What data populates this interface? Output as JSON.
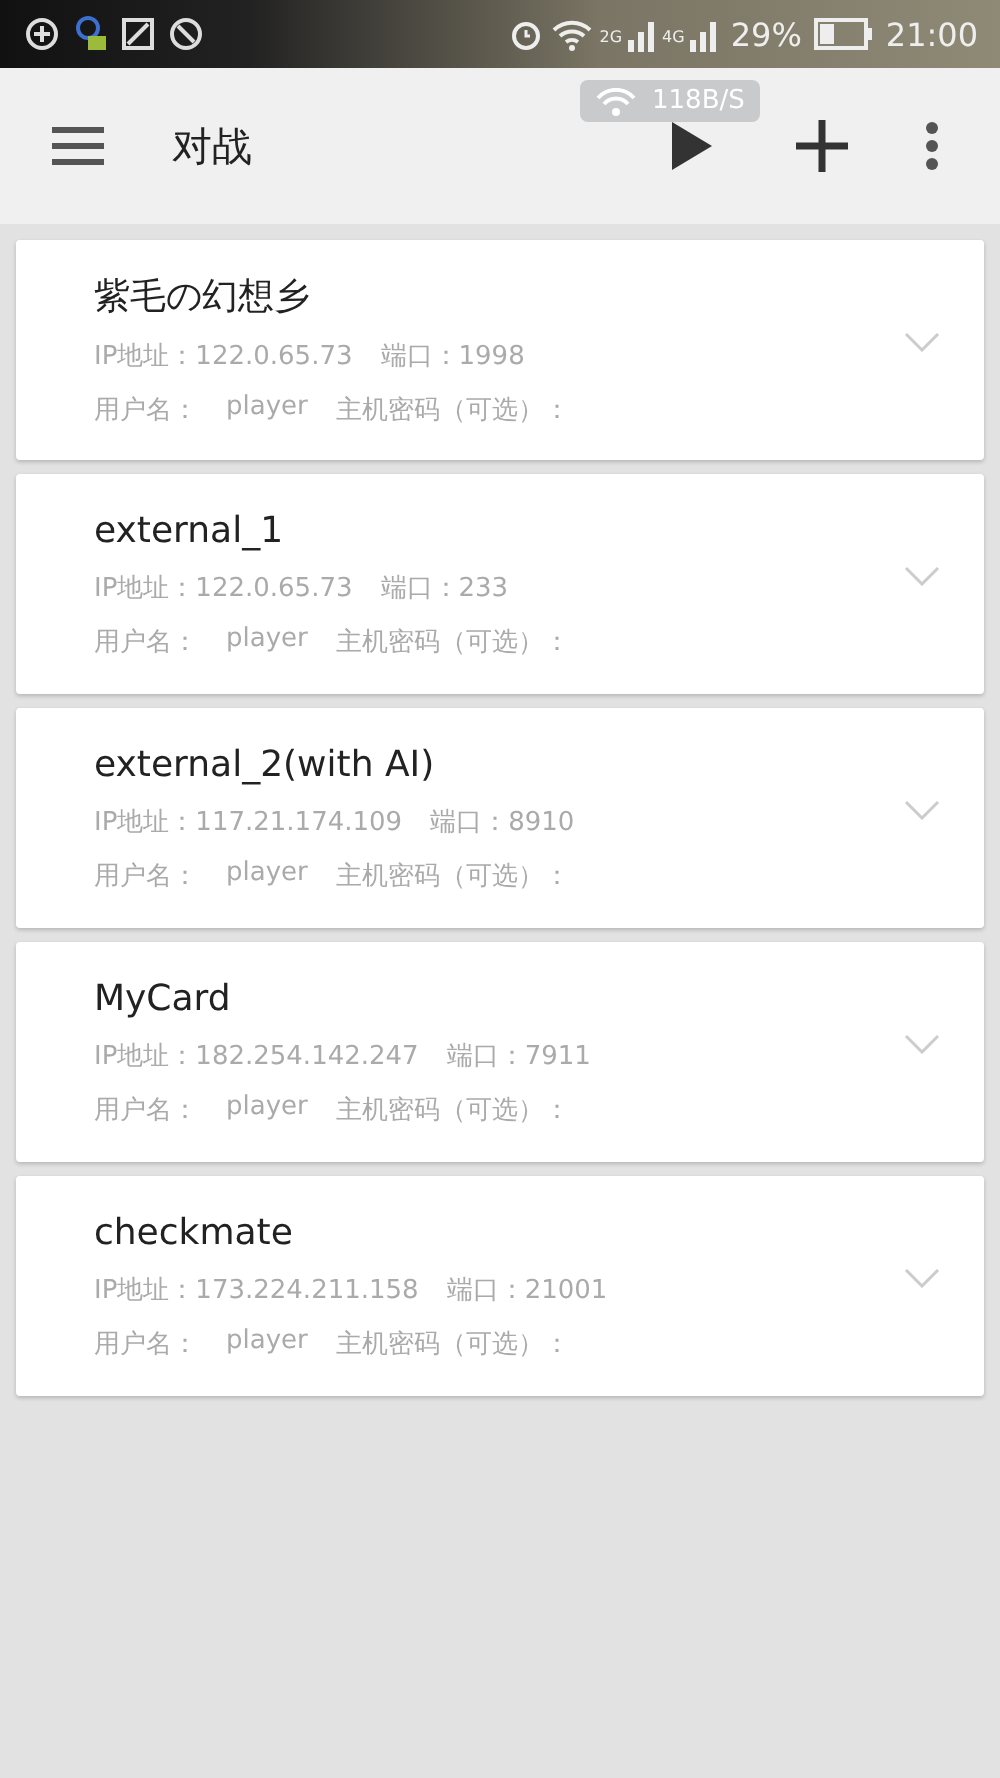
{
  "status_bar": {
    "signal_labels": [
      "2G",
      "4G"
    ],
    "battery": "29%",
    "time": "21:00"
  },
  "speed_badge": "118B/S",
  "toolbar": {
    "title": "对战"
  },
  "servers": [
    {
      "name": "紫毛の幻想乡",
      "ip": "IP地址：122.0.65.73",
      "port": "端口：1998",
      "user_label": "用户名：",
      "user": "player",
      "password_label": "主机密码（可选）："
    },
    {
      "name": "external_1",
      "ip": "IP地址：122.0.65.73",
      "port": "端口：233",
      "user_label": "用户名：",
      "user": "player",
      "password_label": "主机密码（可选）："
    },
    {
      "name": "external_2(with AI)",
      "ip": "IP地址：117.21.174.109",
      "port": "端口：8910",
      "user_label": "用户名：",
      "user": "player",
      "password_label": "主机密码（可选）："
    },
    {
      "name": "MyCard",
      "ip": "IP地址：182.254.142.247",
      "port": "端口：7911",
      "user_label": "用户名：",
      "user": "player",
      "password_label": "主机密码（可选）："
    },
    {
      "name": "checkmate",
      "ip": "IP地址：173.224.211.158",
      "port": "端口：21001",
      "user_label": "用户名：",
      "user": "player",
      "password_label": "主机密码（可选）："
    }
  ]
}
